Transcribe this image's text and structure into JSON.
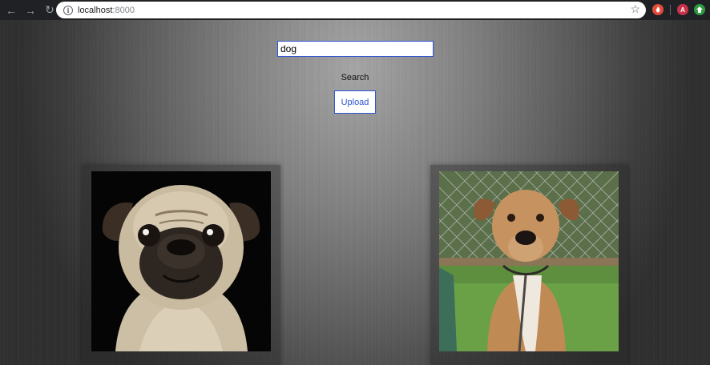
{
  "browser": {
    "url_host": "localhost",
    "url_port": ":8000",
    "icons": [
      "back-icon",
      "forward-icon",
      "reload-icon",
      "info-icon",
      "star-icon"
    ],
    "extensions": [
      {
        "letter": "",
        "color": "#e44b3a"
      },
      {
        "letter": "A",
        "color": "#c8324a"
      },
      {
        "letter": "",
        "color": "#2e9a3f"
      }
    ]
  },
  "search": {
    "value": "dog",
    "label": "Search"
  },
  "upload": {
    "label": "Upload"
  },
  "colors": {
    "accent": "#2f55d4"
  }
}
